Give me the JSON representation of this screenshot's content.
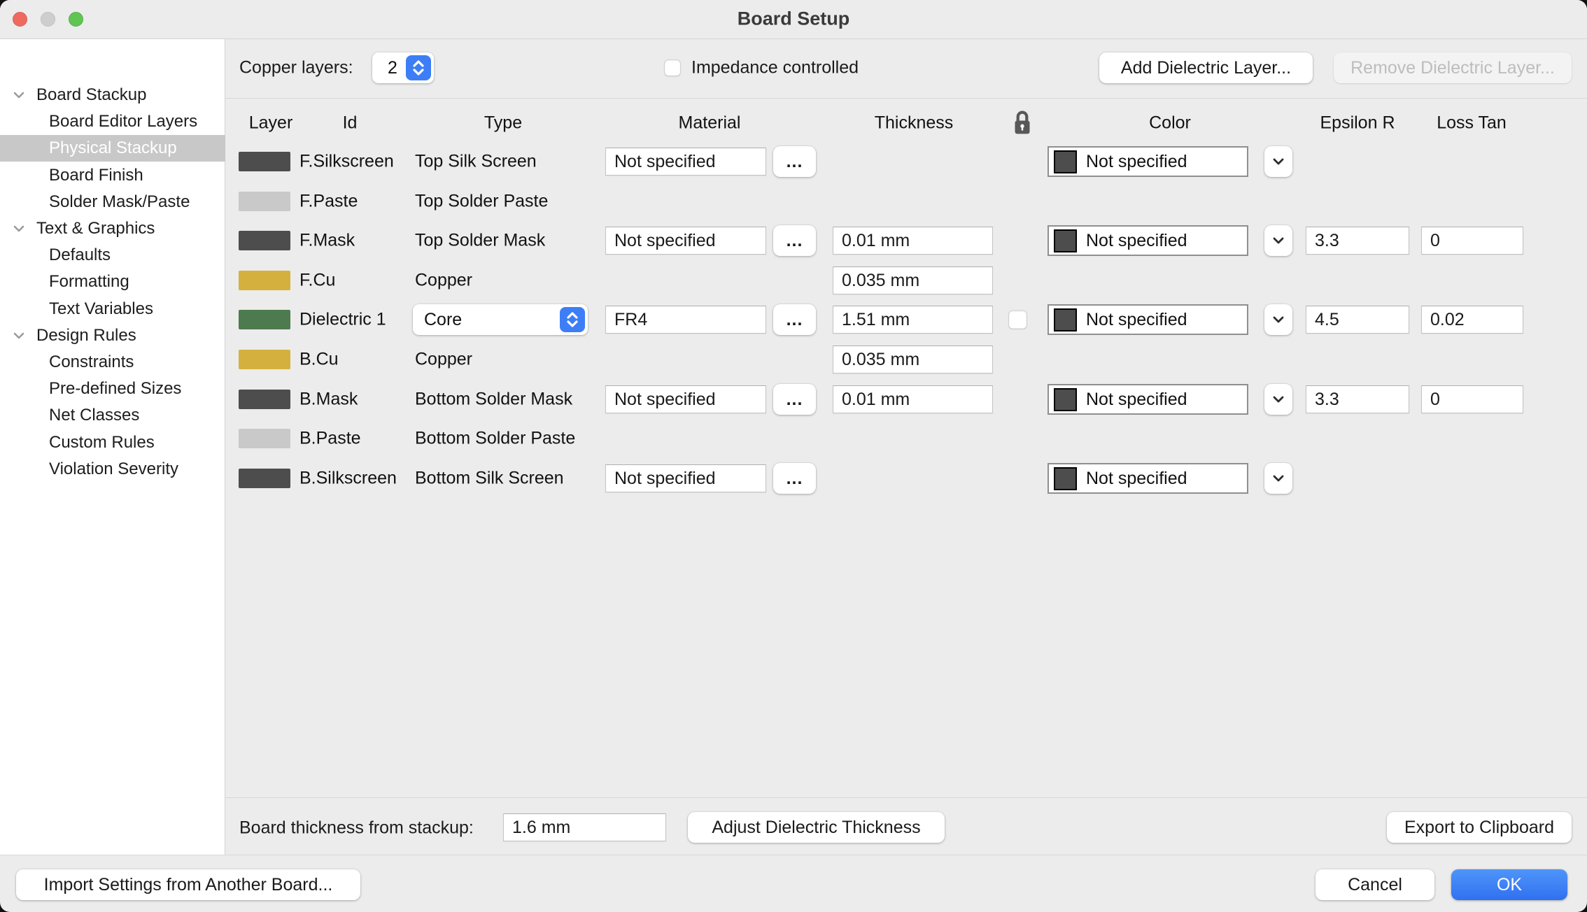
{
  "window": {
    "title": "Board Setup"
  },
  "sidebar": {
    "items": [
      {
        "label": "Board Stackup"
      },
      {
        "label": "Board Editor Layers"
      },
      {
        "label": "Physical Stackup"
      },
      {
        "label": "Board Finish"
      },
      {
        "label": "Solder Mask/Paste"
      },
      {
        "label": "Text & Graphics"
      },
      {
        "label": "Defaults"
      },
      {
        "label": "Formatting"
      },
      {
        "label": "Text Variables"
      },
      {
        "label": "Design Rules"
      },
      {
        "label": "Constraints"
      },
      {
        "label": "Pre-defined Sizes"
      },
      {
        "label": "Net Classes"
      },
      {
        "label": "Custom Rules"
      },
      {
        "label": "Violation Severity"
      }
    ],
    "selected": "Physical Stackup"
  },
  "toolbar": {
    "copper_layers_label": "Copper layers:",
    "copper_layers_value": "2",
    "impedance_label": "Impedance controlled",
    "impedance_checked": false,
    "add_dielectric_label": "Add Dielectric Layer...",
    "remove_dielectric_label": "Remove Dielectric Layer..."
  },
  "table": {
    "headers": {
      "layer": "Layer",
      "id": "Id",
      "type": "Type",
      "material": "Material",
      "thickness": "Thickness",
      "color": "Color",
      "epsilon": "Epsilon R",
      "loss": "Loss Tan"
    },
    "ellipsis_label": "...",
    "swatch_color": "#4d4d4d",
    "rows": [
      {
        "id": "F.Silkscreen",
        "type": "Top Silk Screen",
        "chip": "#4d4d4d",
        "material": "Not specified",
        "color_label": "Not specified"
      },
      {
        "id": "F.Paste",
        "type": "Top Solder Paste",
        "chip": "#c9c9c9"
      },
      {
        "id": "F.Mask",
        "type": "Top Solder Mask",
        "chip": "#4d4d4d",
        "material": "Not specified",
        "thickness": "0.01 mm",
        "color_label": "Not specified",
        "epsilon": "3.3",
        "loss_tan": "0"
      },
      {
        "id": "F.Cu",
        "type": "Copper",
        "chip": "#d4b13f",
        "thickness": "0.035 mm"
      },
      {
        "id": "Dielectric 1",
        "type_select": "Core",
        "chip": "#4e7a50",
        "material": "FR4",
        "thickness": "1.51 mm",
        "color_label": "Not specified",
        "epsilon": "4.5",
        "loss_tan": "0.02",
        "locked": false
      },
      {
        "id": "B.Cu",
        "type": "Copper",
        "chip": "#d4b13f",
        "thickness": "0.035 mm"
      },
      {
        "id": "B.Mask",
        "type": "Bottom Solder Mask",
        "chip": "#4d4d4d",
        "material": "Not specified",
        "thickness": "0.01 mm",
        "color_label": "Not specified",
        "epsilon": "3.3",
        "loss_tan": "0"
      },
      {
        "id": "B.Paste",
        "type": "Bottom Solder Paste",
        "chip": "#c9c9c9"
      },
      {
        "id": "B.Silkscreen",
        "type": "Bottom Silk Screen",
        "chip": "#4d4d4d",
        "material": "Not specified",
        "color_label": "Not specified"
      }
    ]
  },
  "bottom": {
    "thickness_label": "Board thickness from stackup:",
    "thickness_value": "1.6 mm",
    "adjust_button": "Adjust Dielectric Thickness",
    "export_button": "Export to Clipboard"
  },
  "footer": {
    "import_button": "Import Settings from Another Board...",
    "cancel_button": "Cancel",
    "ok_button": "OK"
  },
  "colors": {
    "accent_blue": "#3d7ef7",
    "copper_chip": "#d4b13f",
    "dielectric_chip": "#4e7a50",
    "dark_layer_chip": "#4d4d4d",
    "light_layer_chip": "#c9c9c9"
  }
}
